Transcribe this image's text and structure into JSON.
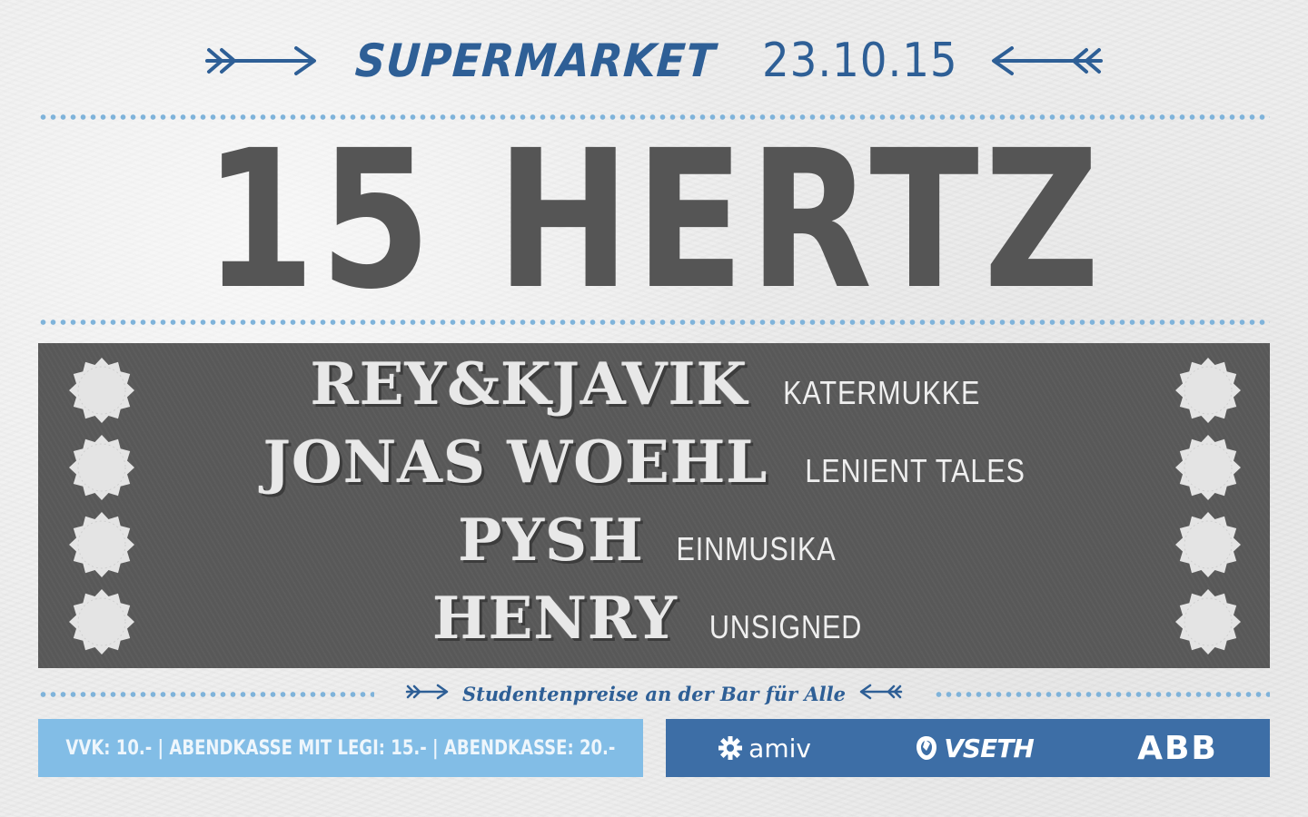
{
  "colors": {
    "primary_blue": "#2e5f96",
    "light_blue": "#82bde6",
    "panel_gray": "#5a5a5a",
    "title_gray": "#555555",
    "sponsor_blue": "#3d6ea6"
  },
  "header": {
    "venue": "SUPERMARKET",
    "date": "23.10.15",
    "left_icon": "arrow-right-icon",
    "right_icon": "arrow-left-icon"
  },
  "title": "15 HERTZ",
  "lineup": [
    {
      "artist": "REY&KJAVIK",
      "label": "KATERMUKKE"
    },
    {
      "artist": "JONAS WOEHL",
      "label": "LENIENT TALES"
    },
    {
      "artist": "PYSH",
      "label": "EINMUSIKA"
    },
    {
      "artist": "HENRY",
      "label": "UNSIGNED"
    }
  ],
  "bar_note": "Studentenpreise an der Bar für Alle",
  "prices": "VVK: 10.- | ABENDKASSE MIT LEGI: 15.- | ABENDKASSE: 20.-",
  "sponsors": [
    {
      "name": "amiv",
      "icon": "gear-icon"
    },
    {
      "name": "VSETH",
      "icon": "vseth-logo-icon"
    },
    {
      "name": "ABB",
      "icon": ""
    }
  ]
}
